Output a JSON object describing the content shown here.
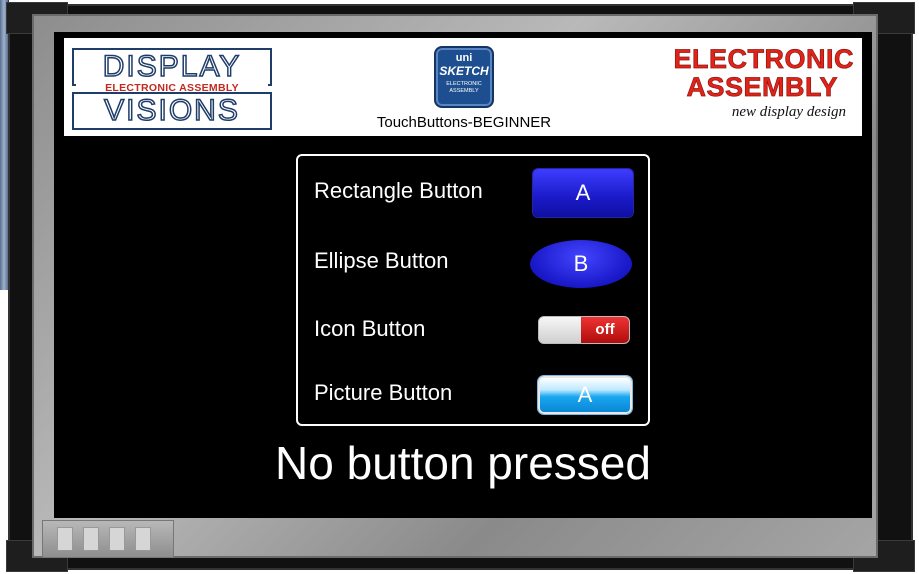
{
  "header": {
    "title": "TouchButtons-BEGINNER",
    "logo_left": {
      "line1": "DISPLAY",
      "line2": "ELECTRONIC ASSEMBLY",
      "line3": "VISIONS"
    },
    "logo_center": {
      "line1": "uni",
      "line2": "SKETCH",
      "line3": "ELECTRONIC ASSEMBLY"
    },
    "logo_right": {
      "line1": "ELECTRONIC",
      "line2": "ASSEMBLY",
      "tagline": "new display design"
    }
  },
  "buttons": {
    "rectangle": {
      "label": "Rectangle Button",
      "button_text": "A"
    },
    "ellipse": {
      "label": "Ellipse Button",
      "button_text": "B"
    },
    "icon": {
      "label": "Icon Button",
      "state_text": "off"
    },
    "picture": {
      "label": "Picture Button",
      "button_text": "A"
    }
  },
  "status": {
    "text": "No button pressed"
  },
  "colors": {
    "button_blue": "#1a1ac8",
    "toggle_red": "#d01818",
    "picture_blue": "#19a7ef",
    "brand_red": "#e2231a",
    "brand_navy": "#1f3d69"
  }
}
